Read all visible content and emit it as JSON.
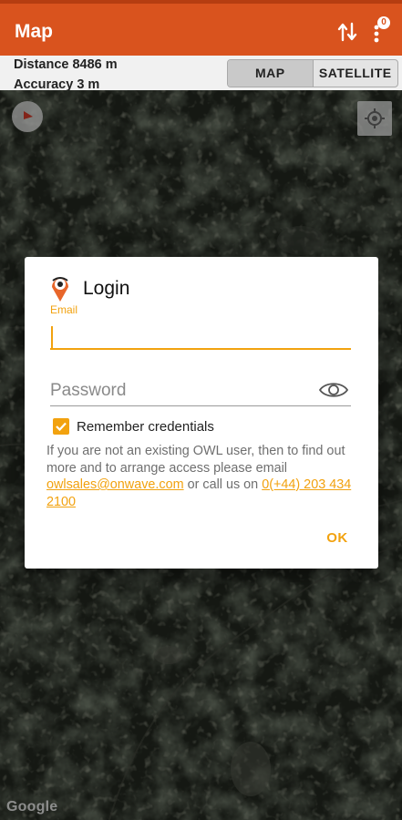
{
  "appbar": {
    "title": "Map",
    "badge_count": "0",
    "swap_icon": "swap-vertical-icon",
    "more_icon": "more-vert-icon",
    "bg_color": "#d9531e"
  },
  "info": {
    "distance": "Distance 8486 m",
    "accuracy": "Accuracy 3 m"
  },
  "map_toggle": {
    "map_label": "MAP",
    "satellite_label": "SATELLITE"
  },
  "map": {
    "attribution": "Google",
    "compass_icon": "compass-icon",
    "locate_icon": "my-location-icon"
  },
  "dialog": {
    "title": "Login",
    "logo_icon": "owl-logo-icon",
    "email_label": "Email",
    "email_value": "",
    "password_placeholder": "Password",
    "eye_icon": "eye-icon",
    "remember_label": "Remember credentials",
    "remember_checked": true,
    "info_text": "If you are not an existing OWL user, then to find out more and to arrange access please email ",
    "email_link": "owlsales@onwave.com",
    "info_mid": " or call us on ",
    "phone_link": "0(+44) 203 434 2100",
    "ok_label": "OK",
    "accent_color": "#f2a20f"
  }
}
